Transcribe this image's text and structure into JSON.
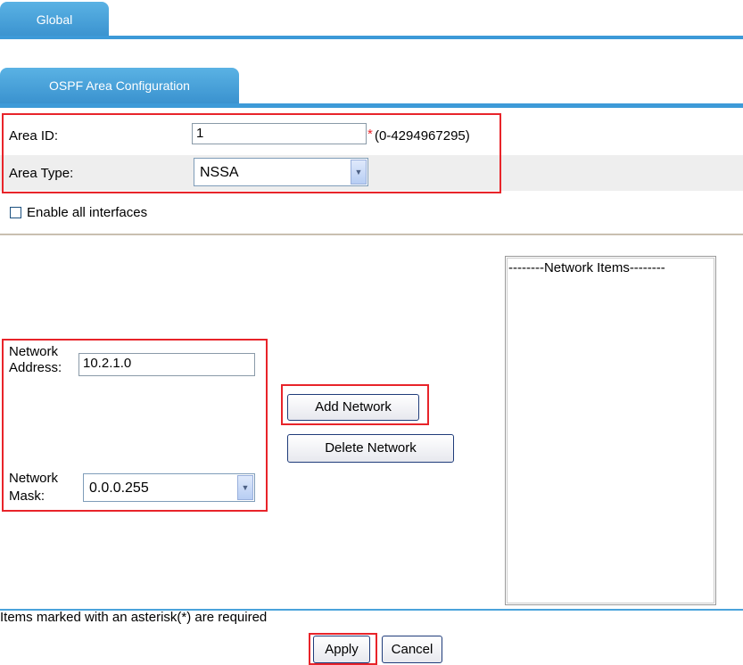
{
  "tabs": {
    "global_label": "Global",
    "ospf_area_label": "OSPF Area Configuration"
  },
  "area_form": {
    "area_id_label": "Area ID:",
    "area_id_value": "1",
    "area_id_required_marker": "*",
    "area_id_range": "(0-4294967295)",
    "area_type_label": "Area Type:",
    "area_type_value": "NSSA"
  },
  "enable_all_interfaces_label": "Enable all interfaces",
  "enable_all_interfaces_checked": false,
  "network": {
    "address_label_line1": "Network",
    "address_label_line2": "Address:",
    "address_value": "10.2.1.0",
    "mask_label_line1": "Network",
    "mask_label_line2": "Mask:",
    "mask_value": "0.0.0.255",
    "add_button": "Add Network",
    "delete_button": "Delete Network",
    "items_header": "--------Network Items--------"
  },
  "footer": {
    "required_note": "Items marked with an asterisk(*) are required",
    "apply_button": "Apply",
    "cancel_button": "Cancel"
  },
  "colors": {
    "tab_blue": "#4aa3db",
    "highlight_red": "#e8242a",
    "row_gray": "#eeeeee"
  }
}
